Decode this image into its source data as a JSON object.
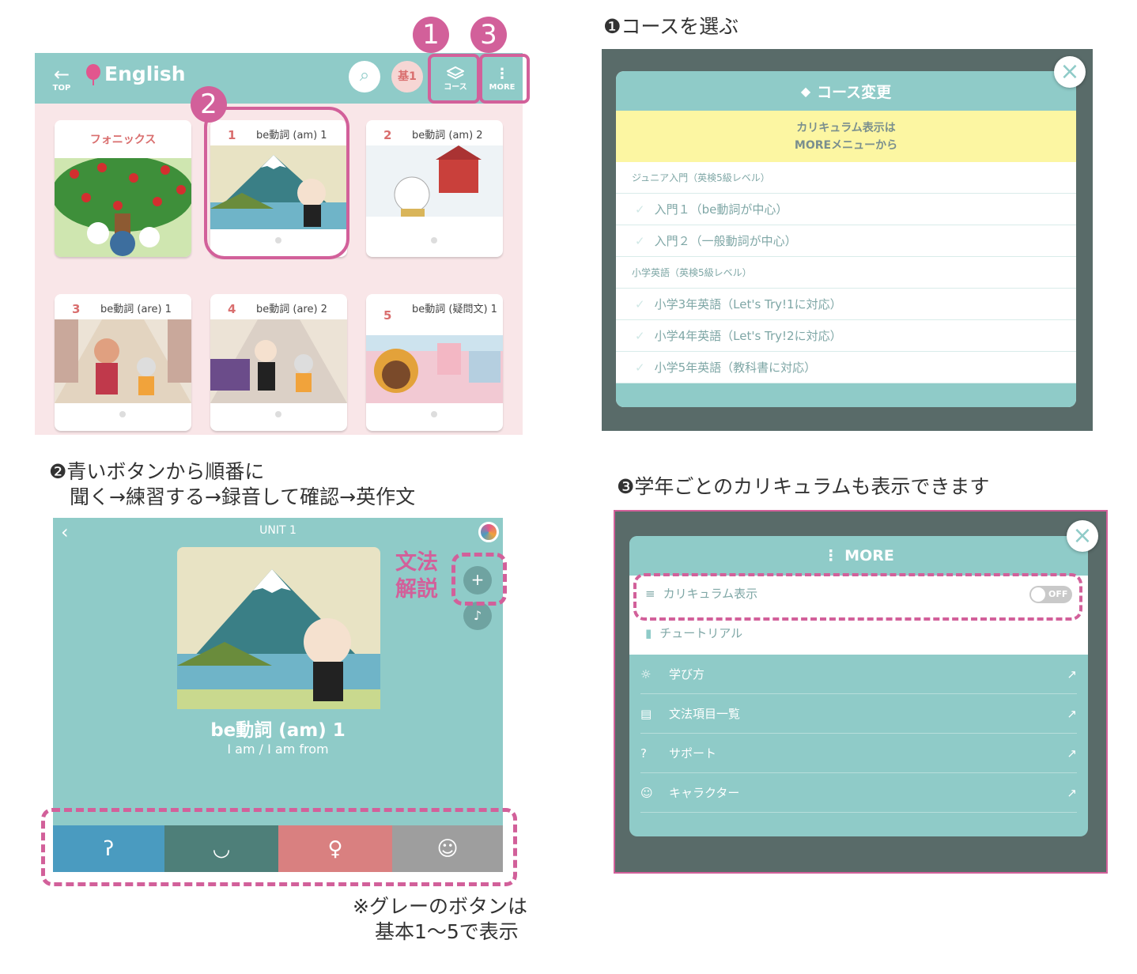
{
  "captions": {
    "c1": "❶コースを選ぶ",
    "c2_line1": "❷青いボタンから順番に",
    "c2_line2": "聞く→練習する→録音して確認→英作文",
    "c3": "❸学年ごとのカリキュラムも表示できます",
    "note_line1": "※グレーのボタンは",
    "note_line2": "基本1〜5で表示"
  },
  "badges": {
    "b1": "1",
    "b2": "2",
    "b3": "3"
  },
  "app_header": {
    "back_label": "TOP",
    "title": "English",
    "level_badge": "基1",
    "course_label": "コース",
    "more_label": "MORE"
  },
  "cards": [
    {
      "num": "",
      "title": "フォニックス"
    },
    {
      "num": "1",
      "title": "be動詞 (am) 1"
    },
    {
      "num": "2",
      "title": "be動詞 (am) 2"
    },
    {
      "num": "3",
      "title": "be動詞 (are) 1"
    },
    {
      "num": "4",
      "title": "be動詞 (are) 2"
    },
    {
      "num": "5",
      "title": "be動詞 (疑問文) 1"
    }
  ],
  "course_modal": {
    "title": "コース変更",
    "notice_line1": "カリキュラム表示は",
    "notice_line2": "MOREメニューから",
    "section1": "ジュニア入門（英検5級レベル）",
    "items1": [
      "入門１（be動詞が中心）",
      "入門２（一般動詞が中心）"
    ],
    "section2": "小学英語（英検5級レベル）",
    "items2": [
      "小学3年英語（Let's Try!1に対応）",
      "小学4年英語（Let's Try!2に対応）",
      "小学5年英語（教科書に対応）"
    ]
  },
  "unit_screen": {
    "unit_title": "UNIT 1",
    "lesson_title": "be動詞 (am) 1",
    "lesson_sub": "I am / I am from",
    "grammar_line1": "文法",
    "grammar_line2": "解説",
    "buttons": [
      {
        "icon": "ear-icon",
        "color": "#4a9bc0"
      },
      {
        "icon": "lips-icon",
        "color": "#4e7f79"
      },
      {
        "icon": "microphone-icon",
        "color": "#d98080"
      },
      {
        "icon": "head-icon",
        "color": "#9e9e9e"
      }
    ]
  },
  "more_modal": {
    "title": "MORE",
    "curriculum_label": "カリキュラム表示",
    "toggle_label": "OFF",
    "tutorial_label": "チュートリアル",
    "links": [
      "学び方",
      "文法項目一覧",
      "サポート",
      "キャラクター"
    ]
  }
}
